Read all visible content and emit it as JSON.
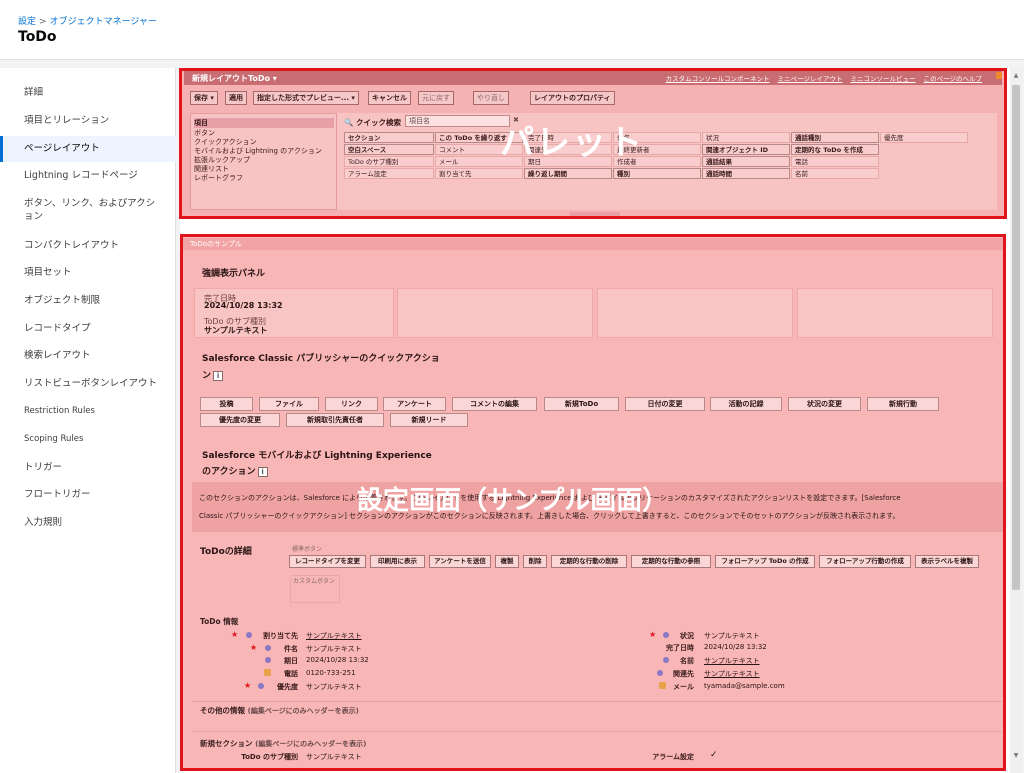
{
  "header": {
    "breadcrumb": [
      "設定",
      "オブジェクトマネージャー"
    ],
    "breadcrumb_sep": ">",
    "title": "ToDo"
  },
  "sidebar": {
    "items": [
      {
        "label": "詳細",
        "active": false
      },
      {
        "label": "項目とリレーション",
        "active": false
      },
      {
        "label": "ページレイアウト",
        "active": true
      },
      {
        "label": "Lightning レコードページ",
        "active": false
      },
      {
        "label": "ボタン、リンク、およびアクション",
        "active": false
      },
      {
        "label": "コンパクトレイアウト",
        "active": false
      },
      {
        "label": "項目セット",
        "active": false
      },
      {
        "label": "オブジェクト制限",
        "active": false
      },
      {
        "label": "レコードタイプ",
        "active": false
      },
      {
        "label": "検索レイアウト",
        "active": false
      },
      {
        "label": "リストビューボタンレイアウト",
        "active": false
      },
      {
        "label": "Restriction Rules",
        "active": false
      },
      {
        "label": "Scoping Rules",
        "active": false
      },
      {
        "label": "トリガー",
        "active": false
      },
      {
        "label": "フロートリガー",
        "active": false
      },
      {
        "label": "入力規則",
        "active": false
      }
    ]
  },
  "palette": {
    "overlay_label": "パレット",
    "layout_title": "新規レイアウトToDo ▾",
    "links": [
      "カスタムコンソールコンポーネント",
      "ミニページレイアウト",
      "ミニコンソールビュー",
      "このページのヘルプ"
    ],
    "toolbar": {
      "save": "保存 ▾",
      "quick_save": "適用",
      "preview": "指定した形式でプレビュー... ▾",
      "cancel": "キャンセル",
      "undo": "元に戻す",
      "redo": "やり直し",
      "properties": "レイアウトのプロパティ"
    },
    "categories": [
      "項目",
      "ボタン",
      "クイックアクション",
      "モバイルおよび Lightning のアクション",
      "拡張ルックアップ",
      "関連リスト",
      "レポートグラフ"
    ],
    "quick_search_label": "クイック検索",
    "quick_search_value": "項目名",
    "quick_search_clear": "✖",
    "fields": [
      [
        "セクション",
        "この ToDo を繰り返す",
        "完了日時",
        "件名",
        "状況",
        "通話種別",
        "優先度"
      ],
      [
        "空白スペース",
        "コメント",
        "関連先",
        "最終更新者",
        "関連オブジェクト ID",
        "定期的な ToDo を作成",
        ""
      ],
      [
        "ToDo のサブ種別",
        "メール",
        "期日",
        "作成者",
        "通話結果",
        "電話",
        ""
      ],
      [
        "アラーム設定",
        "割り当て先",
        "繰り返し期間",
        "種別",
        "通話時間",
        "名前",
        ""
      ]
    ]
  },
  "setting": {
    "overlay_label": "設定画面（サンプル画面）",
    "sample_header": "ToDoのサンプル",
    "highlight_panel_title": "強調表示パネル",
    "highlight_fields": [
      {
        "label": "完了日時",
        "value": "2024/10/28 13:32"
      },
      {
        "label": "ToDo のサブ種別",
        "value": "サンプルテキスト"
      }
    ],
    "classic_title_1": "Salesforce Classic パブリッシャーのクイックアクショ",
    "classic_title_2": "ン",
    "info_icon": "i",
    "classic_actions_row1": [
      "投稿",
      "ファイル",
      "リンク",
      "アンケート",
      "コメントの編集",
      "新規ToDo",
      "日付の変更",
      "活動の記録",
      "状況の変更",
      "新規行動"
    ],
    "classic_actions_row2": [
      "優先度の変更",
      "新規取引先責任者",
      "新規リード"
    ],
    "lightning_title_1": "Salesforce モバイルおよび Lightning Experience",
    "lightning_title_2": "のアクション",
    "desc_line1": "このセクションのアクションは、Salesforce により定義されます。このレイアウトを使用する Lightning Experience および モバイルアプリケーションのカスタマイズされたアクションリストを設定できます。[Salesforce",
    "desc_line2": "Classic パブリッシャーのクイックアクション] セクションのアクションがこのセクションに反映されます。上書きした場合、クリックして上書きすると、このセクションでそのセットのアクションが反映され表示されます。",
    "detail_title": "ToDoの詳細",
    "standard_buttons_label": "標準ボタン",
    "custom_buttons_label": "カスタムボタン",
    "detail_buttons": [
      "レコードタイプを変更",
      "印刷用に表示",
      "アンケートを送信",
      "複製",
      "削除",
      "定期的な行動の削除",
      "定期的な行動の参照",
      "フォローアップ ToDo の作成",
      "フォローアップ行動の作成",
      "表示ラベルを複製"
    ],
    "info_section_title": "ToDo 情報",
    "left_fields": [
      {
        "label": "割り当て先",
        "value": "サンプルテキスト",
        "link": true
      },
      {
        "label": "件名",
        "value": "サンプルテキスト",
        "link": false
      },
      {
        "label": "期日",
        "value": "2024/10/28 13:32",
        "link": false
      },
      {
        "label": "電話",
        "value": "0120-733-251",
        "link": false
      },
      {
        "label": "優先度",
        "value": "サンプルテキスト",
        "link": false
      }
    ],
    "right_fields": [
      {
        "label": "状況",
        "value": "サンプルテキスト",
        "link": false
      },
      {
        "label": "完了日時",
        "value": "2024/10/28 13:32",
        "link": false
      },
      {
        "label": "名前",
        "value": "サンプルテキスト",
        "link": true
      },
      {
        "label": "関連先",
        "value": "サンプルテキスト",
        "link": true
      },
      {
        "label": "メール",
        "value": "tyamada@sample.com",
        "link": false
      }
    ],
    "other_section_title": "その他の情報",
    "other_section_hint": "(編集ページにのみヘッダーを表示)",
    "new_section_title": "新規セクション",
    "new_section_hint": "(編集ページにのみヘッダーを表示)",
    "bottom_left_label": "ToDo のサブ種別",
    "bottom_left_value": "サンプルテキスト",
    "bottom_right_label": "アラーム設定",
    "bottom_right_value": "✓"
  },
  "colors": {
    "accent": "#0070d2",
    "overlay_red": "#e0151b",
    "palette_bg": "#f6b2b2"
  }
}
